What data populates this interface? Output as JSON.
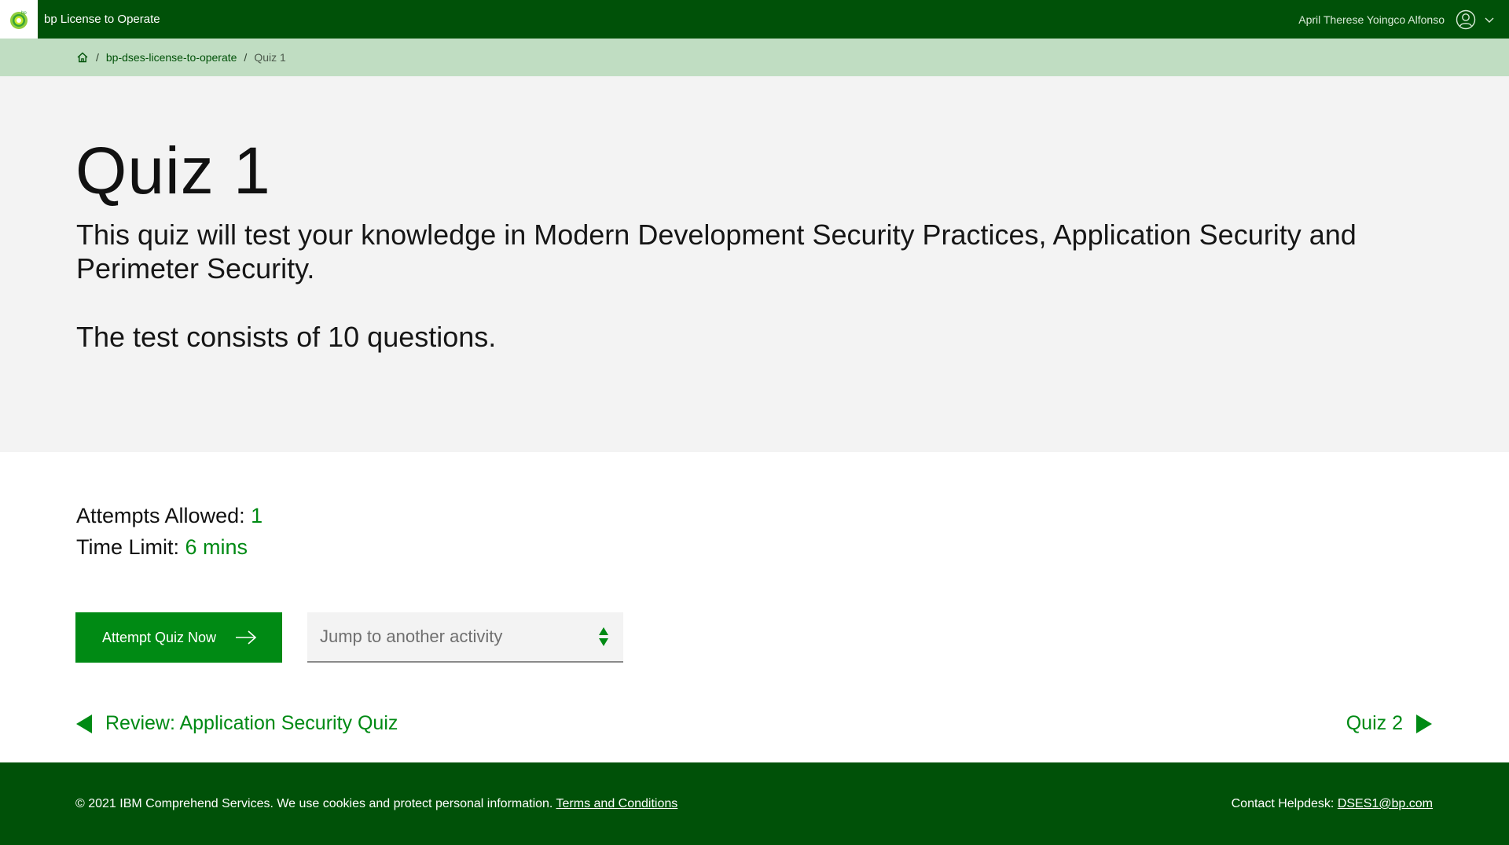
{
  "header": {
    "app_title": "bp License to Operate",
    "user_name": "April Therese Yoingco Alfonso",
    "logo_icon": "bp-helios-logo-icon",
    "user_icon": "user-avatar-icon",
    "menu_icon": "chevron-down-icon"
  },
  "breadcrumb": {
    "home_icon": "home-icon",
    "separator": "/",
    "items": [
      {
        "label": "bp-dses-license-to-operate"
      },
      {
        "label": "Quiz 1"
      }
    ]
  },
  "hero": {
    "title": "Quiz 1",
    "description": "This quiz will test your knowledge in Modern Development Security Practices, Application Security and Perimeter Security.",
    "question_count_text": "The test consists of 10 questions."
  },
  "details": {
    "attempts_label": "Attempts Allowed:",
    "attempts_value": "1",
    "time_label": "Time Limit:",
    "time_value": "6 mins"
  },
  "actions": {
    "attempt_label": "Attempt Quiz Now",
    "jump_placeholder": "Jump to another activity"
  },
  "navigation": {
    "prev_label": "Review: Application Security Quiz",
    "next_label": "Quiz 2"
  },
  "footer": {
    "copyright": "© 2021 IBM Comprehend Services. We use cookies and protect personal information.",
    "terms_label": "Terms and Conditions",
    "helpdesk_label": "Contact Helpdesk:",
    "helpdesk_email": "DSES1@bp.com"
  },
  "colors": {
    "header_green": "#005108",
    "accent_green": "#008a14",
    "breadcrumb_bg": "#c0ddc2",
    "hero_bg": "#f3f3f3"
  }
}
